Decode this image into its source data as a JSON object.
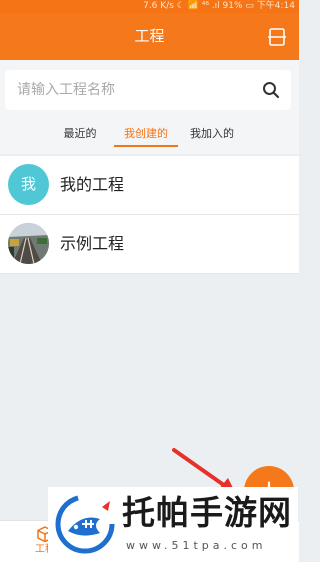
{
  "status_bar": {
    "text": "7.6 K/s ☾ 📶 ⁴⁶ .ıl 91% ▭ 下午4:14"
  },
  "app_bar": {
    "title": "工程"
  },
  "search": {
    "placeholder": "请输入工程名称"
  },
  "tabs": [
    {
      "label": "最近的"
    },
    {
      "label": "我创建的"
    },
    {
      "label": "我加入的"
    }
  ],
  "projects": [
    {
      "name": "我的工程",
      "avatar_text": "我",
      "avatar_color": "#4fc7d4"
    },
    {
      "name": "示例工程",
      "avatar_text": ""
    }
  ],
  "fab": {
    "symbol": "+"
  },
  "bottom_nav": {
    "items": [
      {
        "label": "工程",
        "icon": "cube-icon"
      }
    ]
  },
  "watermark": {
    "title": "托帕手游网",
    "url": "www.51tpa.com"
  },
  "colors": {
    "primary": "#f5781a",
    "active_tab": "#f47416",
    "background": "#eceff1",
    "arrow": "#e8302a"
  }
}
